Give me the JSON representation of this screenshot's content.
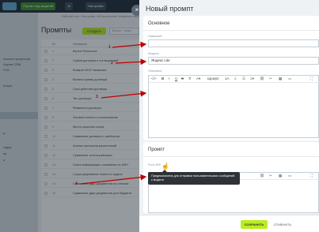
{
  "topbar": {
    "btn_meeting": "Портал под защитой",
    "btn_count": "11",
    "btn_settings": "Настройки"
  },
  "sidebar": {
    "items": [
      "Анализ процессов",
      "Оцени CRM",
      "ГПА",
      "иторы",
      "",
      "",
      "",
      "",
      "",
      "",
      "ы",
      "ездка",
      "ка",
      "и"
    ]
  },
  "breadcrumb": "Рабочий стол  /  Настройки  /  ИИ-ассистенты: Машинное обучение и промпты",
  "list": {
    "title": "Промпты",
    "create_label": "СОЗДАТЬ",
    "filter_placeholder": "Фильтр + поиск",
    "col_id": "ID",
    "col_name": "Название",
    "rows": [
      {
        "id": "1",
        "name": "Шутки Психолога"
      },
      {
        "id": "2",
        "name": "Сумма договора и согласующий"
      },
      {
        "id": "3",
        "name": "Возврат ИНН Заказчика"
      },
      {
        "id": "4",
        "name": "Валюта суммы договора"
      },
      {
        "id": "5",
        "name": "Срок действия договора"
      },
      {
        "id": "6",
        "name": "Тип договора"
      },
      {
        "id": "7",
        "name": "Реквизиты договора"
      },
      {
        "id": "8",
        "name": "Условия оплаты и согласование"
      },
      {
        "id": "9",
        "name": "Место решения спора"
      },
      {
        "id": "10",
        "name": "Сравнение договора с шаблоном"
      },
      {
        "id": "11",
        "name": "Анализ протокола разногласий"
      },
      {
        "id": "12",
        "name": "Сравнение отчета ревизора"
      },
      {
        "id": "13",
        "name": "Поиск информации о компании по ИНН"
      },
      {
        "id": "14",
        "name": "Структурирование плана по задаче"
      },
      {
        "id": "15",
        "name": "Сравнение двух документов на отличие"
      },
      {
        "id": "16",
        "name": "Сравнение двух документов для бюджета"
      }
    ]
  },
  "panel": {
    "title": "Новый промпт",
    "section_basic": "Основное",
    "label_name": "Название*",
    "name_value": "",
    "label_model": "Модель",
    "model_value": "Яндекс Lite",
    "label_description": "Описание",
    "toolbar_font": "Шрифт",
    "section_prompt": "Промпт",
    "label_role": "Роль ИИ*",
    "tooltip": "Предназначена для отправки пользовательских сообщений к модели",
    "save_label": "СОХРАНИТЬ",
    "cancel_label": "ОТМЕНИТЬ"
  },
  "markers": [
    "1",
    "2",
    "3",
    "4"
  ],
  "colors": {
    "accent": "#bbed21",
    "arrow": "#c00000",
    "topbar": "#1f2a35"
  }
}
